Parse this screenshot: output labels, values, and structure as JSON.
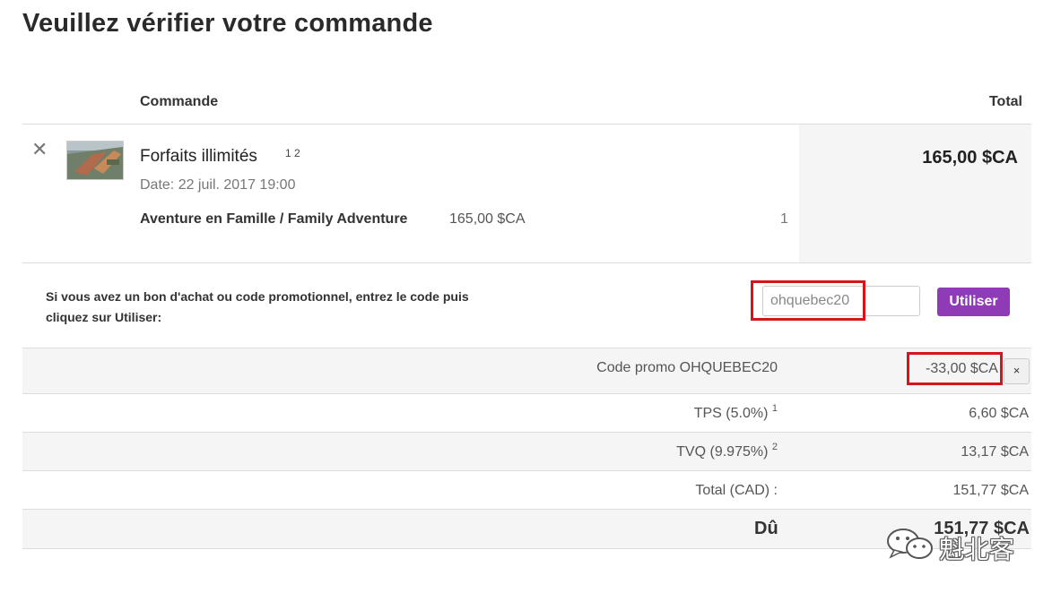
{
  "page": {
    "title": "Veuillez vérifier votre commande"
  },
  "table_header": {
    "order": "Commande",
    "total": "Total"
  },
  "item": {
    "remove_symbol": "✕",
    "title": "Forfaits illimités",
    "superscripts": "1 2",
    "date": "Date: 22 juil. 2017 19:00",
    "total": "165,00 $CA",
    "variant": {
      "name": "Aventure en Famille / Family Adventure",
      "price": "165,00 $CA",
      "quantity": "1"
    }
  },
  "promo": {
    "instructions": "Si vous avez un bon d'achat ou code promotionnel, entrez le code puis cliquez sur Utiliser:",
    "input_value": "ohquebec20",
    "apply_label": "Utiliser"
  },
  "summary": {
    "discount": {
      "label": "Code promo OHQUEBEC20",
      "value": "-33,00 $CA",
      "remove_label": "×"
    },
    "tps": {
      "label": "TPS (5.0%)",
      "sup": "1",
      "value": "6,60 $CA"
    },
    "tvq": {
      "label": "TVQ (9.975%)",
      "sup": "2",
      "value": "13,17 $CA"
    },
    "total": {
      "label": "Total (CAD) :",
      "value": "151,77 $CA"
    },
    "due": {
      "label": "Dû",
      "value": "151,77 $CA"
    }
  },
  "watermark": {
    "text": "魁北客",
    "icon": "wechat-icon"
  },
  "colors": {
    "accent": "#8e3bb5",
    "highlight": "#d6151b",
    "panel": "#f5f5f5"
  }
}
